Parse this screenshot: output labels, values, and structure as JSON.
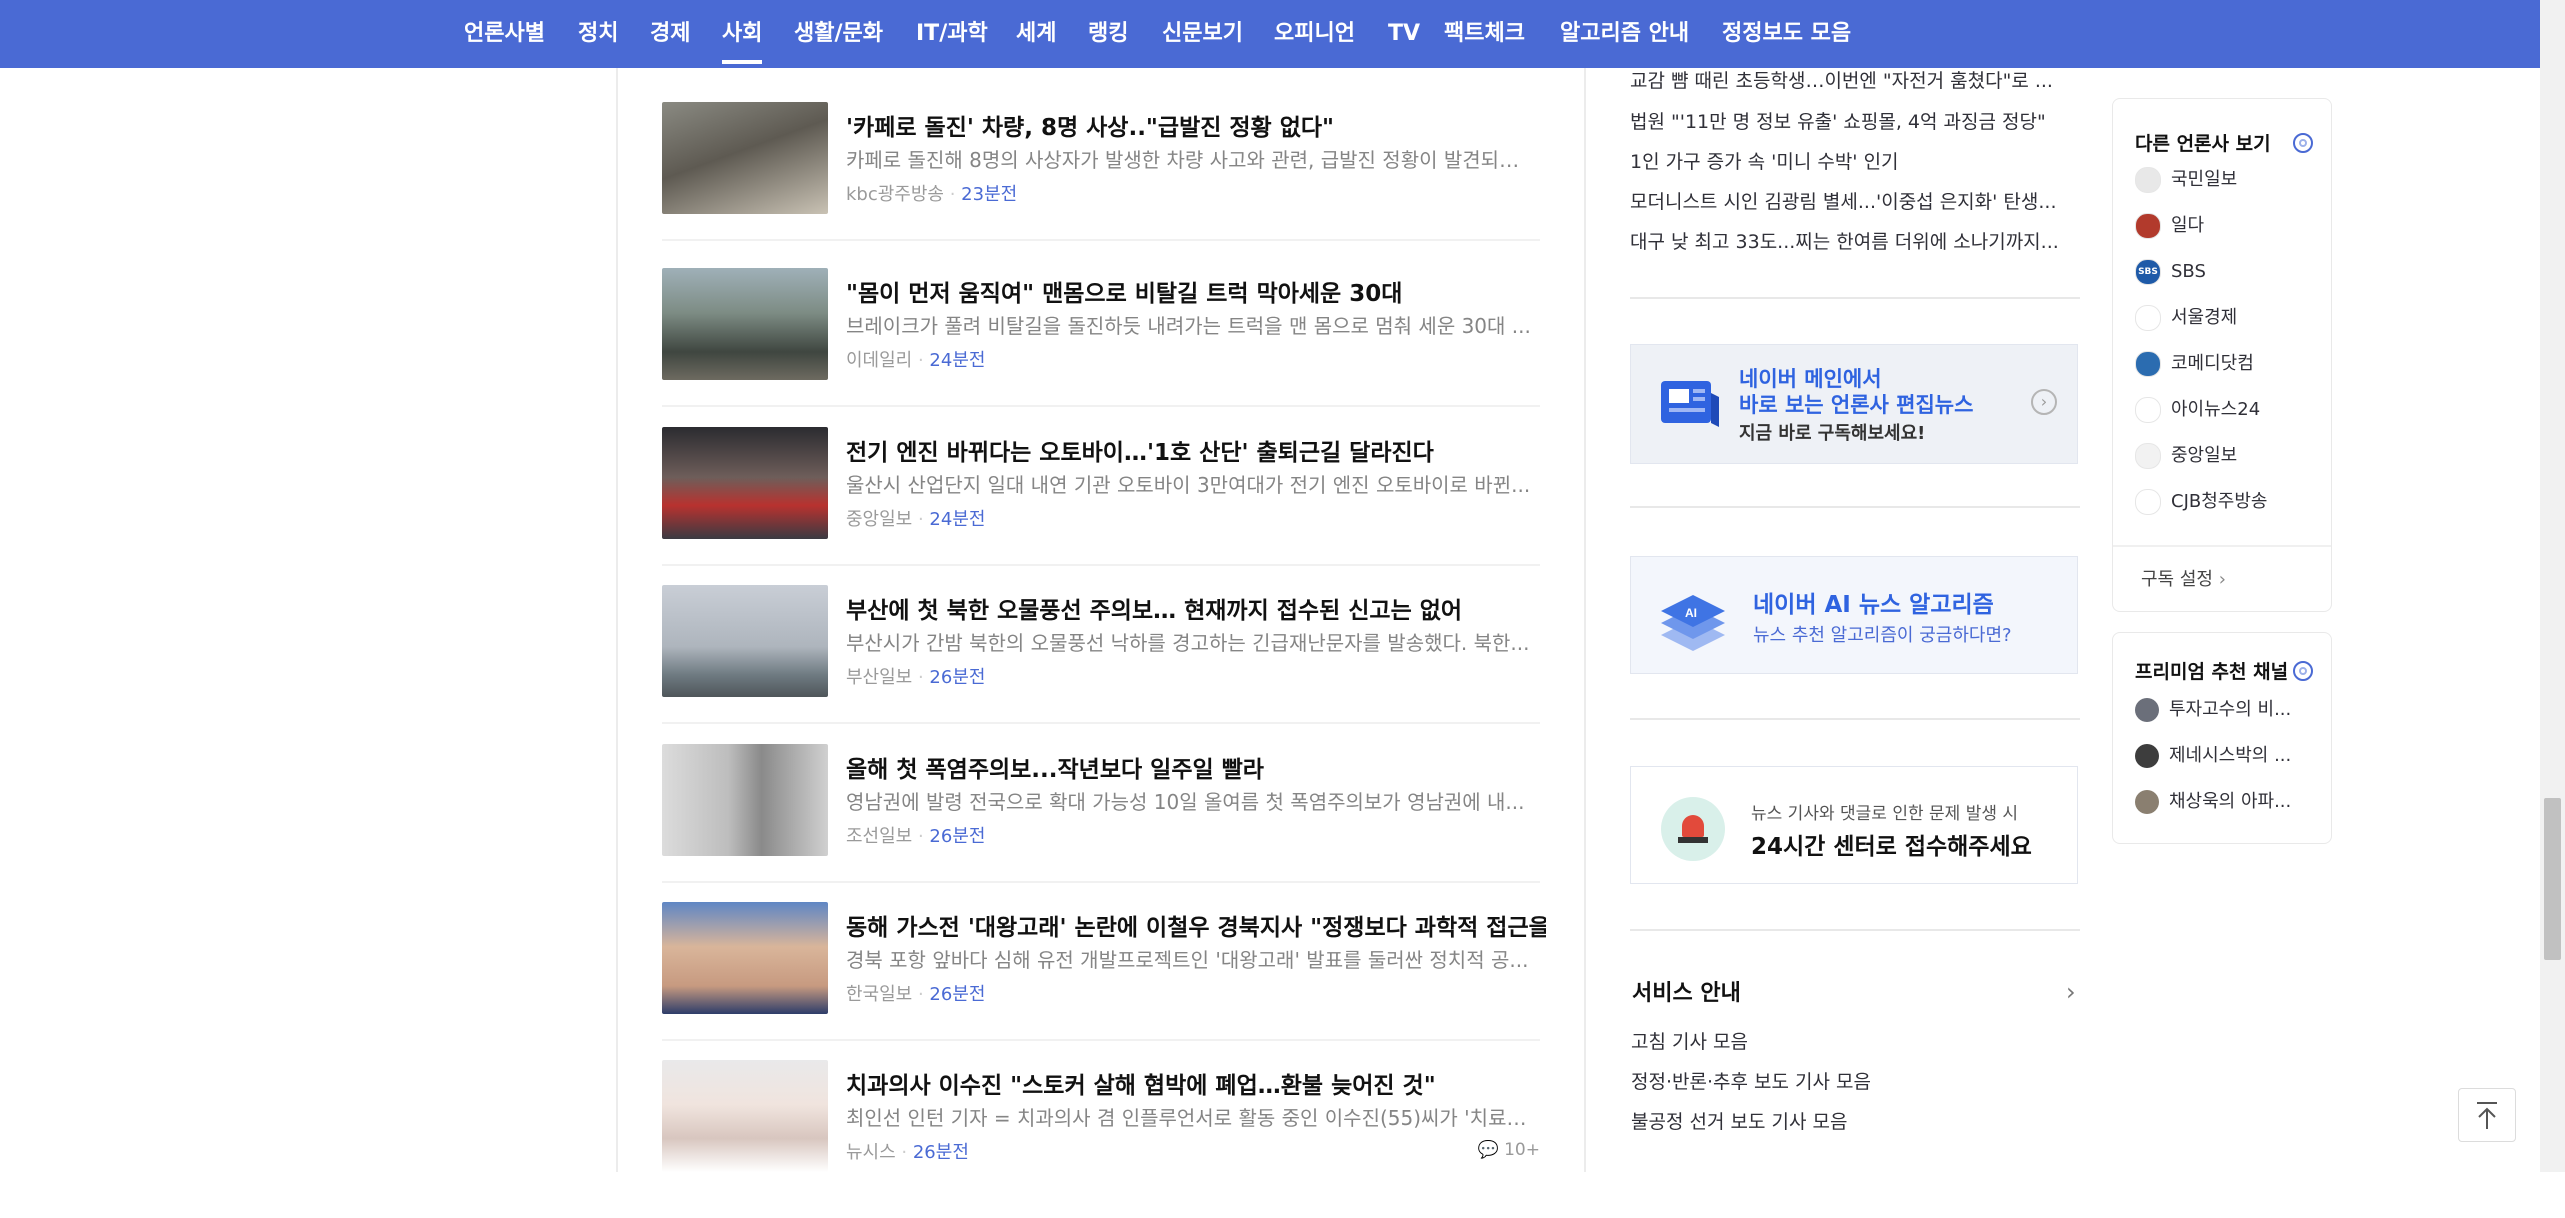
{
  "nav": {
    "items": [
      {
        "label": "언론사별"
      },
      {
        "label": "정치"
      },
      {
        "label": "경제"
      },
      {
        "label": "사회",
        "active": true
      },
      {
        "label": "생활/문화"
      },
      {
        "label": "IT/과학"
      },
      {
        "label": "세계"
      },
      {
        "label": "랭킹"
      },
      {
        "label": "신문보기"
      },
      {
        "label": "오피니언"
      },
      {
        "label": "TV"
      },
      {
        "label": "팩트체크"
      },
      {
        "label": "알고리즘 안내"
      },
      {
        "label": "정정보도 모음"
      }
    ]
  },
  "articles": [
    {
      "title": "'카페로 돌진' 차량, 8명 사상..\"급발진 정황 없다\"",
      "summary": "카페로 돌진해 8명의 사상자가 발생한 차량 사고와 관련, 급발진 정황이 발견되지...",
      "source": "kbc광주방송",
      "time": "23분전"
    },
    {
      "title": "\"몸이 먼저 움직여\" 맨몸으로 비탈길 트럭 막아세운 30대",
      "summary": "브레이크가 풀려 비탈길을 돌진하듯 내려가는 트럭을 맨 몸으로 멈춰 세운 30대 ...",
      "source": "이데일리",
      "time": "24분전"
    },
    {
      "title": "전기 엔진 바뀌다는 오토바이…'1호 산단' 출퇴근길 달라진다",
      "summary": "울산시 산업단지 일대 내연 기관 오토바이 3만여대가 전기 엔진 오토바이로 바뀐...",
      "source": "중앙일보",
      "time": "24분전"
    },
    {
      "title": "부산에 첫 북한 오물풍선 주의보… 현재까지 접수된 신고는 없어",
      "summary": "부산시가 간밤 북한의 오물풍선 낙하를 경고하는 긴급재난문자를 발송했다. 북한...",
      "source": "부산일보",
      "time": "26분전"
    },
    {
      "title": "올해 첫 폭염주의보...작년보다 일주일 빨라",
      "summary": "영남권에 발령 전국으로 확대 가능성 10일 올여름 첫 폭염주의보가 영남권에 내...",
      "source": "조선일보",
      "time": "26분전"
    },
    {
      "title": "동해 가스전 '대왕고래' 논란에 이철우 경북지사 \"정쟁보다 과학적 접근을\"",
      "summary": "경북 포항 앞바다 심해 유전 개발프로젝트인 '대왕고래' 발표를 둘러싼 정치적 공...",
      "source": "한국일보",
      "time": "26분전"
    },
    {
      "title": "치과의사 이수진 \"스토커 살해 협박에 폐업…환불 늦어진 것\"",
      "summary": "최인선 인턴 기자 = 치과의사 겸 인플루언서로 활동 중인 이수진(55)씨가 '치료비 ...",
      "source": "뉴시스",
      "time": "26분전",
      "comments": "10+"
    }
  ],
  "ranking_lines": [
    "교감 뺨 때린 초등학생…이번엔 \"자전거 훔쳤다\"로 ...",
    "법원 \"'11만 명 정보 유출' 쇼핑몰, 4억 과징금 정당\"",
    "1인 가구 증가 속 '미니 수박' 인기",
    "모더니스트 시인 김광림 별세...'이중섭 은지화' 탄생...",
    "대구 낮 최고 33도...찌는 한여름 더위에 소나기까지..."
  ],
  "banners": {
    "main_news": {
      "line1": "네이버 메인에서",
      "line2": "바로 보는 언론사 편집뉴스",
      "line3": "지금 바로 구독해보세요!"
    },
    "ai": {
      "title": "네이버 AI 뉴스 알고리즘",
      "subtitle": "뉴스 추천 알고리즘이 궁금하다면?"
    },
    "report": {
      "line1": "뉴스 기사와 댓글로 인한 문제 발생 시",
      "line2": "24시간 센터로 접수해주세요"
    }
  },
  "service": {
    "title": "서비스 안내",
    "links": [
      "고침 기사 모음",
      "정정·반론·추후 보도 기사 모음",
      "불공정 선거 보도 기사 모음"
    ]
  },
  "other_press": {
    "title": "다른 언론사 보기",
    "items": [
      {
        "name": "국민일보",
        "color": "#e8e8e8",
        "text": ""
      },
      {
        "name": "일다",
        "color": "#b23a2c",
        "text": ""
      },
      {
        "name": "SBS",
        "color": "#1e5aa8",
        "text": "SBS"
      },
      {
        "name": "서울경제",
        "color": "#ffffff",
        "text": ""
      },
      {
        "name": "코메디닷컴",
        "color": "#2b6cb0",
        "text": ""
      },
      {
        "name": "아이뉴스24",
        "color": "#ffffff",
        "text": ""
      },
      {
        "name": "중앙일보",
        "color": "#f2f2f2",
        "text": ""
      },
      {
        "name": "CJB청주방송",
        "color": "#ffffff",
        "text": "CJB"
      }
    ],
    "settings_label": "구독 설정"
  },
  "premium": {
    "title": "프리미엄 추천 채널",
    "items": [
      "투자고수의 비...",
      "제네시스박의 ...",
      "채상욱의 아파..."
    ]
  }
}
